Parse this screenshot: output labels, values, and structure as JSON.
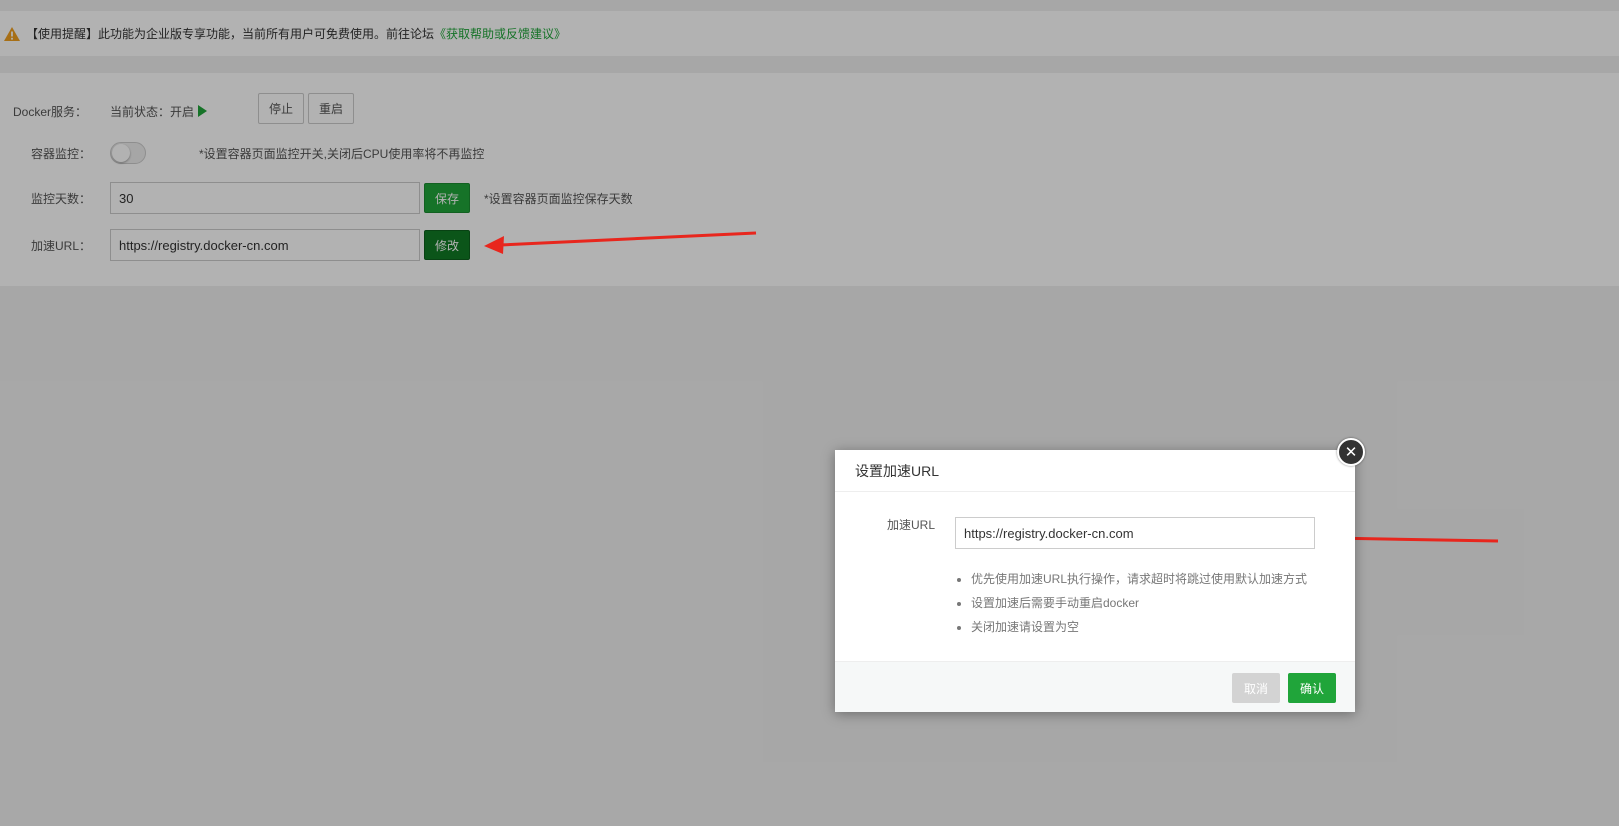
{
  "notice": {
    "icon": "warning-icon",
    "text": "【使用提醒】此功能为企业版专享功能，当前所有用户可免费使用。前往论坛",
    "link": "《获取帮助或反馈建议》",
    "link_color": "#20a53a"
  },
  "docker_service": {
    "label": "Docker服务：",
    "status_text": "当前状态：开启",
    "status_icon": "play-icon",
    "stop_label": "停止",
    "restart_label": "重启"
  },
  "container_monitor": {
    "label": "容器监控：",
    "toggle_on": false,
    "hint": "*设置容器页面监控开关,关闭后CPU使用率将不再监控"
  },
  "monitor_days": {
    "label": "监控天数：",
    "value": "30",
    "save_label": "保存",
    "hint": "*设置容器页面监控保存天数"
  },
  "accel_url": {
    "label": "加速URL：",
    "value": "https://registry.docker-cn.com",
    "modify_label": "修改"
  },
  "dialog": {
    "title": "设置加速URL",
    "close_icon": "close-icon",
    "field_label": "加速URL",
    "field_value": "https://registry.docker-cn.com",
    "tips": [
      "优先使用加速URL执行操作，请求超时将跳过使用默认加速方式",
      "设置加速后需要手动重启docker",
      "关闭加速请设置为空"
    ],
    "cancel_label": "取消",
    "confirm_label": "确认"
  },
  "colors": {
    "accent": "#20a53a",
    "annotation_arrow": "#e8261d"
  }
}
